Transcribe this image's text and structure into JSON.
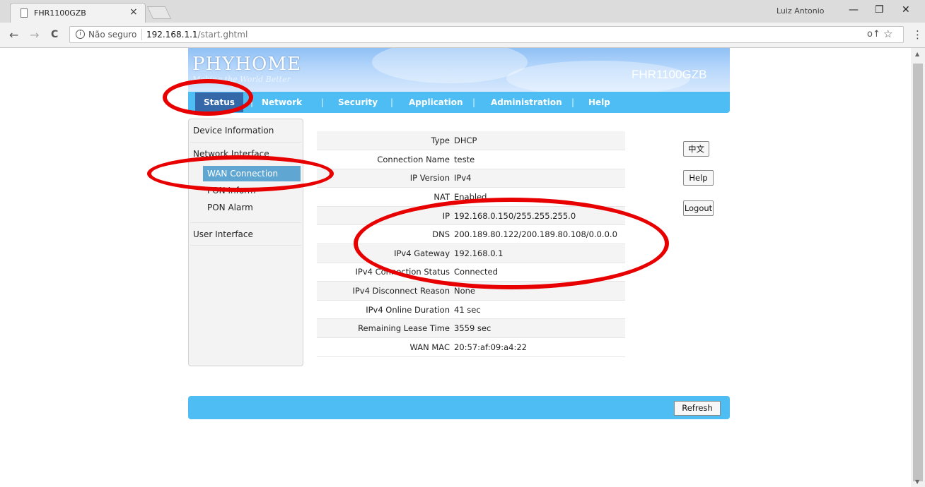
{
  "browser": {
    "tab_title": "FHR1100GZB",
    "tab_close": "×",
    "user_name": "Luiz Antonio",
    "minimize": "—",
    "restore": "❐",
    "close": "✕",
    "back": "←",
    "forward": "→",
    "reload": "C",
    "security_text": "Não seguro",
    "url_host": "192.168.1.1",
    "url_path": "/start.ghtml",
    "key_icon": "o↑",
    "star_icon": "☆",
    "menu_icon": "⋮"
  },
  "header": {
    "logo": "PHYHOME",
    "slogan": "Making the World Better",
    "model": "FHR1100GZB"
  },
  "menu": {
    "items": [
      "Status",
      "Network",
      "Security",
      "Application",
      "Administration",
      "Help"
    ],
    "separator": "|",
    "active": "Status"
  },
  "sidebar": {
    "device_information": "Device Information",
    "network_interface": "Network Interface",
    "wan_connection": "WAN Connection",
    "pon_inform": "PON Inform",
    "pon_alarm": "PON Alarm",
    "user_interface": "User Interface"
  },
  "wan_info": [
    {
      "label": "Type",
      "value": "DHCP"
    },
    {
      "label": "Connection Name",
      "value": "teste"
    },
    {
      "label": "IP Version",
      "value": "IPv4"
    },
    {
      "label": "NAT",
      "value": "Enabled"
    },
    {
      "label": "IP",
      "value": "192.168.0.150/255.255.255.0"
    },
    {
      "label": "DNS",
      "value": "200.189.80.122/200.189.80.108/0.0.0.0"
    },
    {
      "label": "IPv4 Gateway",
      "value": "192.168.0.1"
    },
    {
      "label": "IPv4 Connection Status",
      "value": "Connected"
    },
    {
      "label": "IPv4 Disconnect Reason",
      "value": "None"
    },
    {
      "label": "IPv4 Online Duration",
      "value": "41 sec"
    },
    {
      "label": "Remaining Lease Time",
      "value": "3559 sec"
    },
    {
      "label": "WAN MAC",
      "value": "20:57:af:09:a4:22"
    }
  ],
  "buttons": {
    "language": "中文",
    "help": "Help",
    "logout": "Logout",
    "refresh": "Refresh"
  },
  "annotation_color": "#e80000"
}
